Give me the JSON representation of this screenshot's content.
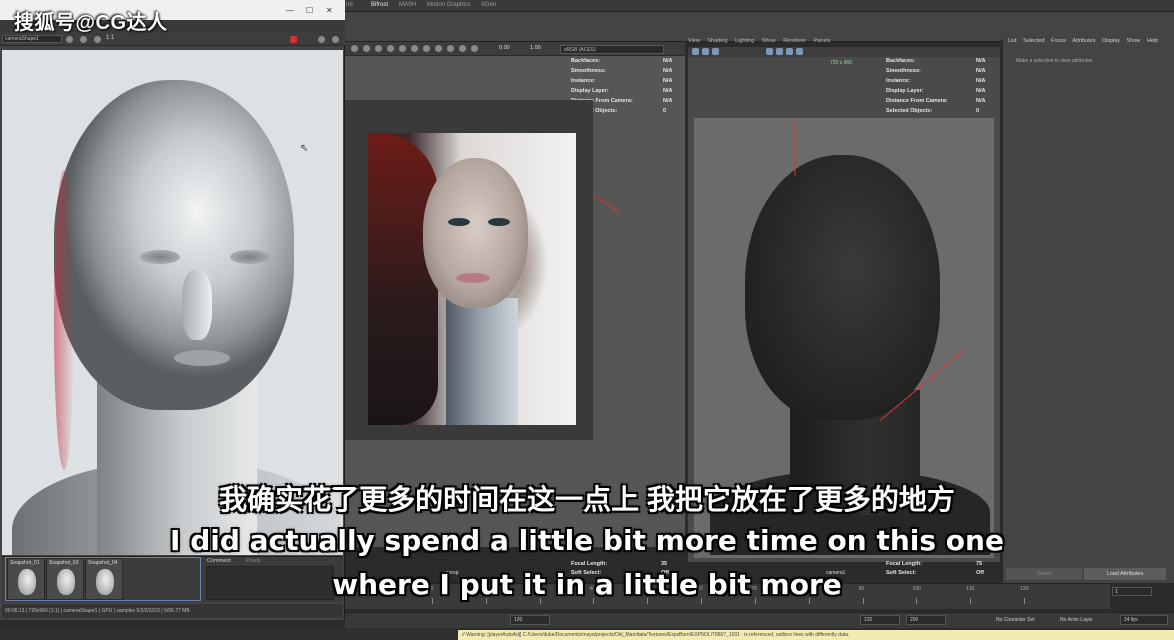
{
  "watermark": "搜狐号@CG达人",
  "subtitles": {
    "chinese": "我确实花了更多的时间在这一点上 我把它放在了更多的地方",
    "english_line1": "I did actually spend a little bit more time on this one",
    "english_line2": "where I put it in a little bit more"
  },
  "top_tabs": [
    "Bifrost",
    "MASH",
    "Motion Graphics",
    "XGen"
  ],
  "render_view": {
    "camera_select": "cameraShape1",
    "ratio_label": "1:1",
    "snapshots": [
      "Snapshot_01",
      "Snapshot_03",
      "Snapshot_04"
    ],
    "tabs": {
      "comment": "Comment",
      "pixels": "Pixels"
    },
    "status": "00:06:13 | 720x960 (1:1) | cameraShape1 | GPU | samples 5/2/2/2/2/2 | 5/06.77 MB"
  },
  "left_viewport": {
    "colorspace": "sRGB (ACES)",
    "time_a": "0.00",
    "time_b": "1.00",
    "hud": [
      {
        "label": "Backfaces:",
        "value": "N/A"
      },
      {
        "label": "Smoothness:",
        "value": "N/A"
      },
      {
        "label": "Instance:",
        "value": "N/A"
      },
      {
        "label": "Display Layer:",
        "value": "N/A"
      },
      {
        "label": "Distance From Camera:",
        "value": "N/A"
      },
      {
        "label": "Selected Objects:",
        "value": "0"
      }
    ],
    "focal": [
      {
        "label": "Focal Length:",
        "value": "35"
      },
      {
        "label": "Soft Select:",
        "value": "Off"
      }
    ],
    "camera_label": "persp"
  },
  "right_viewport": {
    "menu": [
      "View",
      "Shading",
      "Lighting",
      "Show",
      "Renderer",
      "Panels"
    ],
    "resolution": "720 x 960",
    "hud": [
      {
        "label": "Backfaces:",
        "value": "N/A"
      },
      {
        "label": "Smoothness:",
        "value": "N/A"
      },
      {
        "label": "Instance:",
        "value": "N/A"
      },
      {
        "label": "Display Layer:",
        "value": "N/A"
      },
      {
        "label": "Distance From Camera:",
        "value": "N/A"
      },
      {
        "label": "Selected Objects:",
        "value": "0"
      }
    ],
    "focal": [
      {
        "label": "Focal Length:",
        "value": "75"
      },
      {
        "label": "Soft Select:",
        "value": "Off"
      }
    ],
    "camera_label": "camera1"
  },
  "attribute_editor": {
    "menu": [
      "List",
      "Selected",
      "Focus",
      "Attributes",
      "Display",
      "Show",
      "Help"
    ],
    "hint": "Make a selection to view attributes",
    "select_button": "Select",
    "load_button": "Load Attributes"
  },
  "timeline": {
    "ticks": [
      "10",
      "20",
      "30",
      "40",
      "50",
      "60",
      "70",
      "80",
      "90",
      "100",
      "110",
      "120"
    ],
    "current_frame": "1"
  },
  "range": {
    "start": "120",
    "end_a": "120",
    "end_b": "200",
    "character_set": "No Character Set",
    "anim_layer": "No Anim Layer",
    "fps": "24 fps"
  },
  "command_line": "// Warning: [playerAutoAdj] C:/Users/duke/Documents/maya/projects/Old_Man/data/Textures/ExpsBorn/EXP5OLIT8807_1001 : is referenced, outliers lines with differently data."
}
